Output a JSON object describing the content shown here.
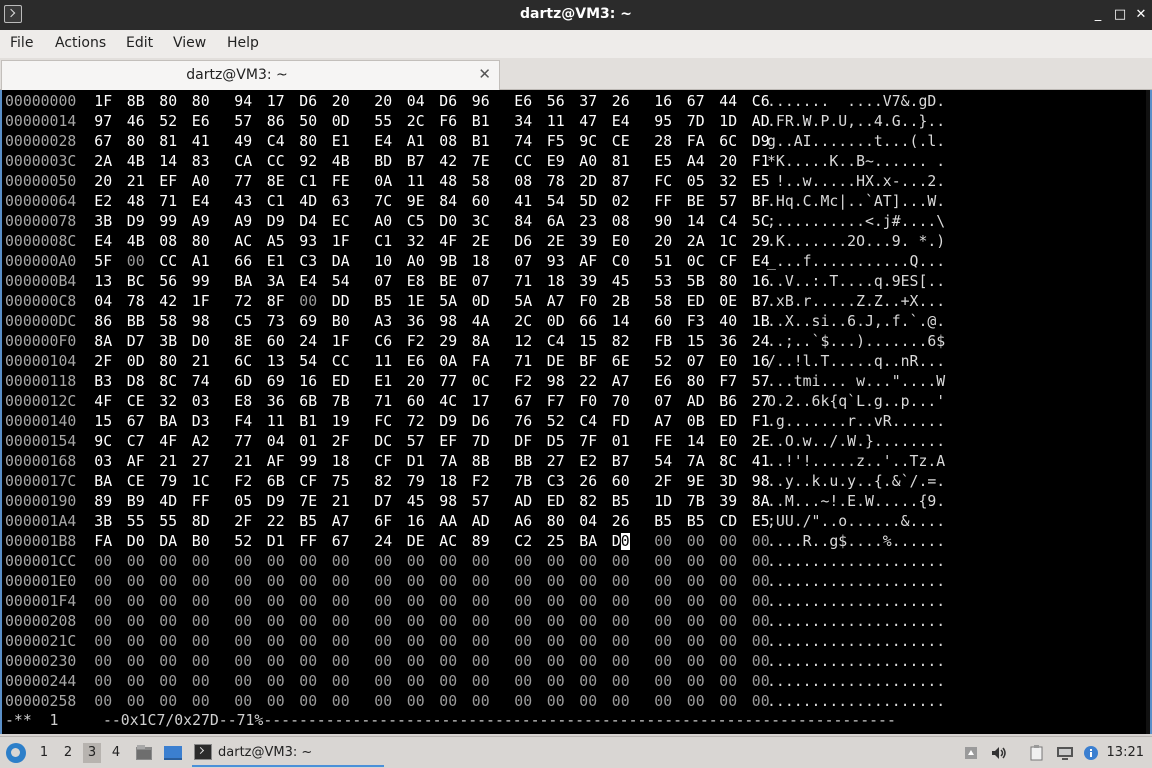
{
  "window": {
    "title": "dartz@VM3: ~",
    "controls": [
      "_",
      "□",
      "✕"
    ]
  },
  "menu": [
    "File",
    "Actions",
    "Edit",
    "View",
    "Help"
  ],
  "tab": {
    "label": "dartz@VM3: ~",
    "close": "✕"
  },
  "hexdump": {
    "rows": [
      {
        "addr": "00000000",
        "bytes": [
          "1F",
          "8B",
          "80",
          "80",
          "94",
          "17",
          "D6",
          "20",
          "20",
          "04",
          "D6",
          "96",
          "E6",
          "56",
          "37",
          "26",
          "16",
          "67",
          "44",
          "C6"
        ],
        "ascii": ".......  ....V7&.gD."
      },
      {
        "addr": "00000014",
        "bytes": [
          "97",
          "46",
          "52",
          "E6",
          "57",
          "86",
          "50",
          "0D",
          "55",
          "2C",
          "F6",
          "B1",
          "34",
          "11",
          "47",
          "E4",
          "95",
          "7D",
          "1D",
          "AD"
        ],
        "ascii": ".FR.W.P.U,..4.G..}.."
      },
      {
        "addr": "00000028",
        "bytes": [
          "67",
          "80",
          "81",
          "41",
          "49",
          "C4",
          "80",
          "E1",
          "E4",
          "A1",
          "08",
          "B1",
          "74",
          "F5",
          "9C",
          "CE",
          "28",
          "FA",
          "6C",
          "D9"
        ],
        "ascii": "g..AI.......t...(.l."
      },
      {
        "addr": "0000003C",
        "bytes": [
          "2A",
          "4B",
          "14",
          "83",
          "CA",
          "CC",
          "92",
          "4B",
          "BD",
          "B7",
          "42",
          "7E",
          "CC",
          "E9",
          "A0",
          "81",
          "E5",
          "A4",
          "20",
          "F1"
        ],
        "ascii": "*K.....K..B~...... ."
      },
      {
        "addr": "00000050",
        "bytes": [
          "20",
          "21",
          "EF",
          "A0",
          "77",
          "8E",
          "C1",
          "FE",
          "0A",
          "11",
          "48",
          "58",
          "08",
          "78",
          "2D",
          "87",
          "FC",
          "05",
          "32",
          "E5"
        ],
        "ascii": " !..w.....HX.x-...2."
      },
      {
        "addr": "00000064",
        "bytes": [
          "E2",
          "48",
          "71",
          "E4",
          "43",
          "C1",
          "4D",
          "63",
          "7C",
          "9E",
          "84",
          "60",
          "41",
          "54",
          "5D",
          "02",
          "FF",
          "BE",
          "57",
          "BF"
        ],
        "ascii": ".Hq.C.Mc|..`AT]...W."
      },
      {
        "addr": "00000078",
        "bytes": [
          "3B",
          "D9",
          "99",
          "A9",
          "A9",
          "D9",
          "D4",
          "EC",
          "A0",
          "C5",
          "D0",
          "3C",
          "84",
          "6A",
          "23",
          "08",
          "90",
          "14",
          "C4",
          "5C"
        ],
        "ascii": ";..........<.j#....\\"
      },
      {
        "addr": "0000008C",
        "bytes": [
          "E4",
          "4B",
          "08",
          "80",
          "AC",
          "A5",
          "93",
          "1F",
          "C1",
          "32",
          "4F",
          "2E",
          "D6",
          "2E",
          "39",
          "E0",
          "20",
          "2A",
          "1C",
          "29"
        ],
        "ascii": ".K.......2O...9. *.)"
      },
      {
        "addr": "000000A0",
        "bytes": [
          "5F",
          "00",
          "CC",
          "A1",
          "66",
          "E1",
          "C3",
          "DA",
          "10",
          "A0",
          "9B",
          "18",
          "07",
          "93",
          "AF",
          "C0",
          "51",
          "0C",
          "CF",
          "E4"
        ],
        "ascii": "_...f...........Q..."
      },
      {
        "addr": "000000B4",
        "bytes": [
          "13",
          "BC",
          "56",
          "99",
          "BA",
          "3A",
          "E4",
          "54",
          "07",
          "E8",
          "BE",
          "07",
          "71",
          "18",
          "39",
          "45",
          "53",
          "5B",
          "80",
          "16"
        ],
        "ascii": "..V..:.T....q.9ES[.."
      },
      {
        "addr": "000000C8",
        "bytes": [
          "04",
          "78",
          "42",
          "1F",
          "72",
          "8F",
          "00",
          "DD",
          "B5",
          "1E",
          "5A",
          "0D",
          "5A",
          "A7",
          "F0",
          "2B",
          "58",
          "ED",
          "0E",
          "B7"
        ],
        "ascii": ".xB.r.....Z.Z..+X..."
      },
      {
        "addr": "000000DC",
        "bytes": [
          "86",
          "BB",
          "58",
          "98",
          "C5",
          "73",
          "69",
          "B0",
          "A3",
          "36",
          "98",
          "4A",
          "2C",
          "0D",
          "66",
          "14",
          "60",
          "F3",
          "40",
          "1B"
        ],
        "ascii": "..X..si..6.J,.f.`.@."
      },
      {
        "addr": "000000F0",
        "bytes": [
          "8A",
          "D7",
          "3B",
          "D0",
          "8E",
          "60",
          "24",
          "1F",
          "C6",
          "F2",
          "29",
          "8A",
          "12",
          "C4",
          "15",
          "82",
          "FB",
          "15",
          "36",
          "24"
        ],
        "ascii": "..;..`$...).......6$"
      },
      {
        "addr": "00000104",
        "bytes": [
          "2F",
          "0D",
          "80",
          "21",
          "6C",
          "13",
          "54",
          "CC",
          "11",
          "E6",
          "0A",
          "FA",
          "71",
          "DE",
          "BF",
          "6E",
          "52",
          "07",
          "E0",
          "16"
        ],
        "ascii": "/..!l.T.....q..nR..."
      },
      {
        "addr": "00000118",
        "bytes": [
          "B3",
          "D8",
          "8C",
          "74",
          "6D",
          "69",
          "16",
          "ED",
          "E1",
          "20",
          "77",
          "0C",
          "F2",
          "98",
          "22",
          "A7",
          "E6",
          "80",
          "F7",
          "57"
        ],
        "ascii": "...tmi... w...\"....W"
      },
      {
        "addr": "0000012C",
        "bytes": [
          "4F",
          "CE",
          "32",
          "03",
          "E8",
          "36",
          "6B",
          "7B",
          "71",
          "60",
          "4C",
          "17",
          "67",
          "F7",
          "F0",
          "70",
          "07",
          "AD",
          "B6",
          "27"
        ],
        "ascii": "O.2..6k{q`L.g..p...'"
      },
      {
        "addr": "00000140",
        "bytes": [
          "15",
          "67",
          "BA",
          "D3",
          "F4",
          "11",
          "B1",
          "19",
          "FC",
          "72",
          "D9",
          "D6",
          "76",
          "52",
          "C4",
          "FD",
          "A7",
          "0B",
          "ED",
          "F1"
        ],
        "ascii": ".g.......r..vR......"
      },
      {
        "addr": "00000154",
        "bytes": [
          "9C",
          "C7",
          "4F",
          "A2",
          "77",
          "04",
          "01",
          "2F",
          "DC",
          "57",
          "EF",
          "7D",
          "DF",
          "D5",
          "7F",
          "01",
          "FE",
          "14",
          "E0",
          "2E"
        ],
        "ascii": "..O.w../.W.}........"
      },
      {
        "addr": "00000168",
        "bytes": [
          "03",
          "AF",
          "21",
          "27",
          "21",
          "AF",
          "99",
          "18",
          "CF",
          "D1",
          "7A",
          "8B",
          "BB",
          "27",
          "E2",
          "B7",
          "54",
          "7A",
          "8C",
          "41"
        ],
        "ascii": "..!'!.....z..'..Tz.A"
      },
      {
        "addr": "0000017C",
        "bytes": [
          "BA",
          "CE",
          "79",
          "1C",
          "F2",
          "6B",
          "CF",
          "75",
          "82",
          "79",
          "18",
          "F2",
          "7B",
          "C3",
          "26",
          "60",
          "2F",
          "9E",
          "3D",
          "98"
        ],
        "ascii": "..y..k.u.y..{.&`/.=."
      },
      {
        "addr": "00000190",
        "bytes": [
          "89",
          "B9",
          "4D",
          "FF",
          "05",
          "D9",
          "7E",
          "21",
          "D7",
          "45",
          "98",
          "57",
          "AD",
          "ED",
          "82",
          "B5",
          "1D",
          "7B",
          "39",
          "8A"
        ],
        "ascii": "..M...~!.E.W.....{9."
      },
      {
        "addr": "000001A4",
        "bytes": [
          "3B",
          "55",
          "55",
          "8D",
          "2F",
          "22",
          "B5",
          "A7",
          "6F",
          "16",
          "AA",
          "AD",
          "A6",
          "80",
          "04",
          "26",
          "B5",
          "B5",
          "CD",
          "E5"
        ],
        "ascii": ";UU./\"..o......&...."
      },
      {
        "addr": "000001B8",
        "bytes": [
          "FA",
          "D0",
          "DA",
          "B0",
          "52",
          "D1",
          "FF",
          "67",
          "24",
          "DE",
          "AC",
          "89",
          "C2",
          "25",
          "BA",
          "D0",
          "00",
          "00",
          "00",
          "00"
        ],
        "ascii": "....R..g$....%......"
      },
      {
        "addr": "000001CC",
        "bytes": [
          "00",
          "00",
          "00",
          "00",
          "00",
          "00",
          "00",
          "00",
          "00",
          "00",
          "00",
          "00",
          "00",
          "00",
          "00",
          "00",
          "00",
          "00",
          "00",
          "00"
        ],
        "ascii": "...................."
      },
      {
        "addr": "000001E0",
        "bytes": [
          "00",
          "00",
          "00",
          "00",
          "00",
          "00",
          "00",
          "00",
          "00",
          "00",
          "00",
          "00",
          "00",
          "00",
          "00",
          "00",
          "00",
          "00",
          "00",
          "00"
        ],
        "ascii": "...................."
      },
      {
        "addr": "000001F4",
        "bytes": [
          "00",
          "00",
          "00",
          "00",
          "00",
          "00",
          "00",
          "00",
          "00",
          "00",
          "00",
          "00",
          "00",
          "00",
          "00",
          "00",
          "00",
          "00",
          "00",
          "00"
        ],
        "ascii": "...................."
      },
      {
        "addr": "00000208",
        "bytes": [
          "00",
          "00",
          "00",
          "00",
          "00",
          "00",
          "00",
          "00",
          "00",
          "00",
          "00",
          "00",
          "00",
          "00",
          "00",
          "00",
          "00",
          "00",
          "00",
          "00"
        ],
        "ascii": "...................."
      },
      {
        "addr": "0000021C",
        "bytes": [
          "00",
          "00",
          "00",
          "00",
          "00",
          "00",
          "00",
          "00",
          "00",
          "00",
          "00",
          "00",
          "00",
          "00",
          "00",
          "00",
          "00",
          "00",
          "00",
          "00"
        ],
        "ascii": "...................."
      },
      {
        "addr": "00000230",
        "bytes": [
          "00",
          "00",
          "00",
          "00",
          "00",
          "00",
          "00",
          "00",
          "00",
          "00",
          "00",
          "00",
          "00",
          "00",
          "00",
          "00",
          "00",
          "00",
          "00",
          "00"
        ],
        "ascii": "...................."
      },
      {
        "addr": "00000244",
        "bytes": [
          "00",
          "00",
          "00",
          "00",
          "00",
          "00",
          "00",
          "00",
          "00",
          "00",
          "00",
          "00",
          "00",
          "00",
          "00",
          "00",
          "00",
          "00",
          "00",
          "00"
        ],
        "ascii": "...................."
      },
      {
        "addr": "00000258",
        "bytes": [
          "00",
          "00",
          "00",
          "00",
          "00",
          "00",
          "00",
          "00",
          "00",
          "00",
          "00",
          "00",
          "00",
          "00",
          "00",
          "00",
          "00",
          "00",
          "00",
          "00"
        ],
        "ascii": "...................."
      }
    ],
    "cursor": {
      "row": 22,
      "byte": 15
    },
    "status": "-**  1     --0x1C7/0x27D--71%-----------------------------------------------------------------------"
  },
  "taskbar": {
    "workspaces": [
      "1",
      "2",
      "3",
      "4"
    ],
    "active_workspace": "3",
    "task_label": "dartz@VM3: ~",
    "clock": "13:21"
  },
  "colors": {
    "accent": "#4a90d9",
    "terminal_bg": "#000000",
    "titlebar_bg": "#2b2b2b"
  }
}
